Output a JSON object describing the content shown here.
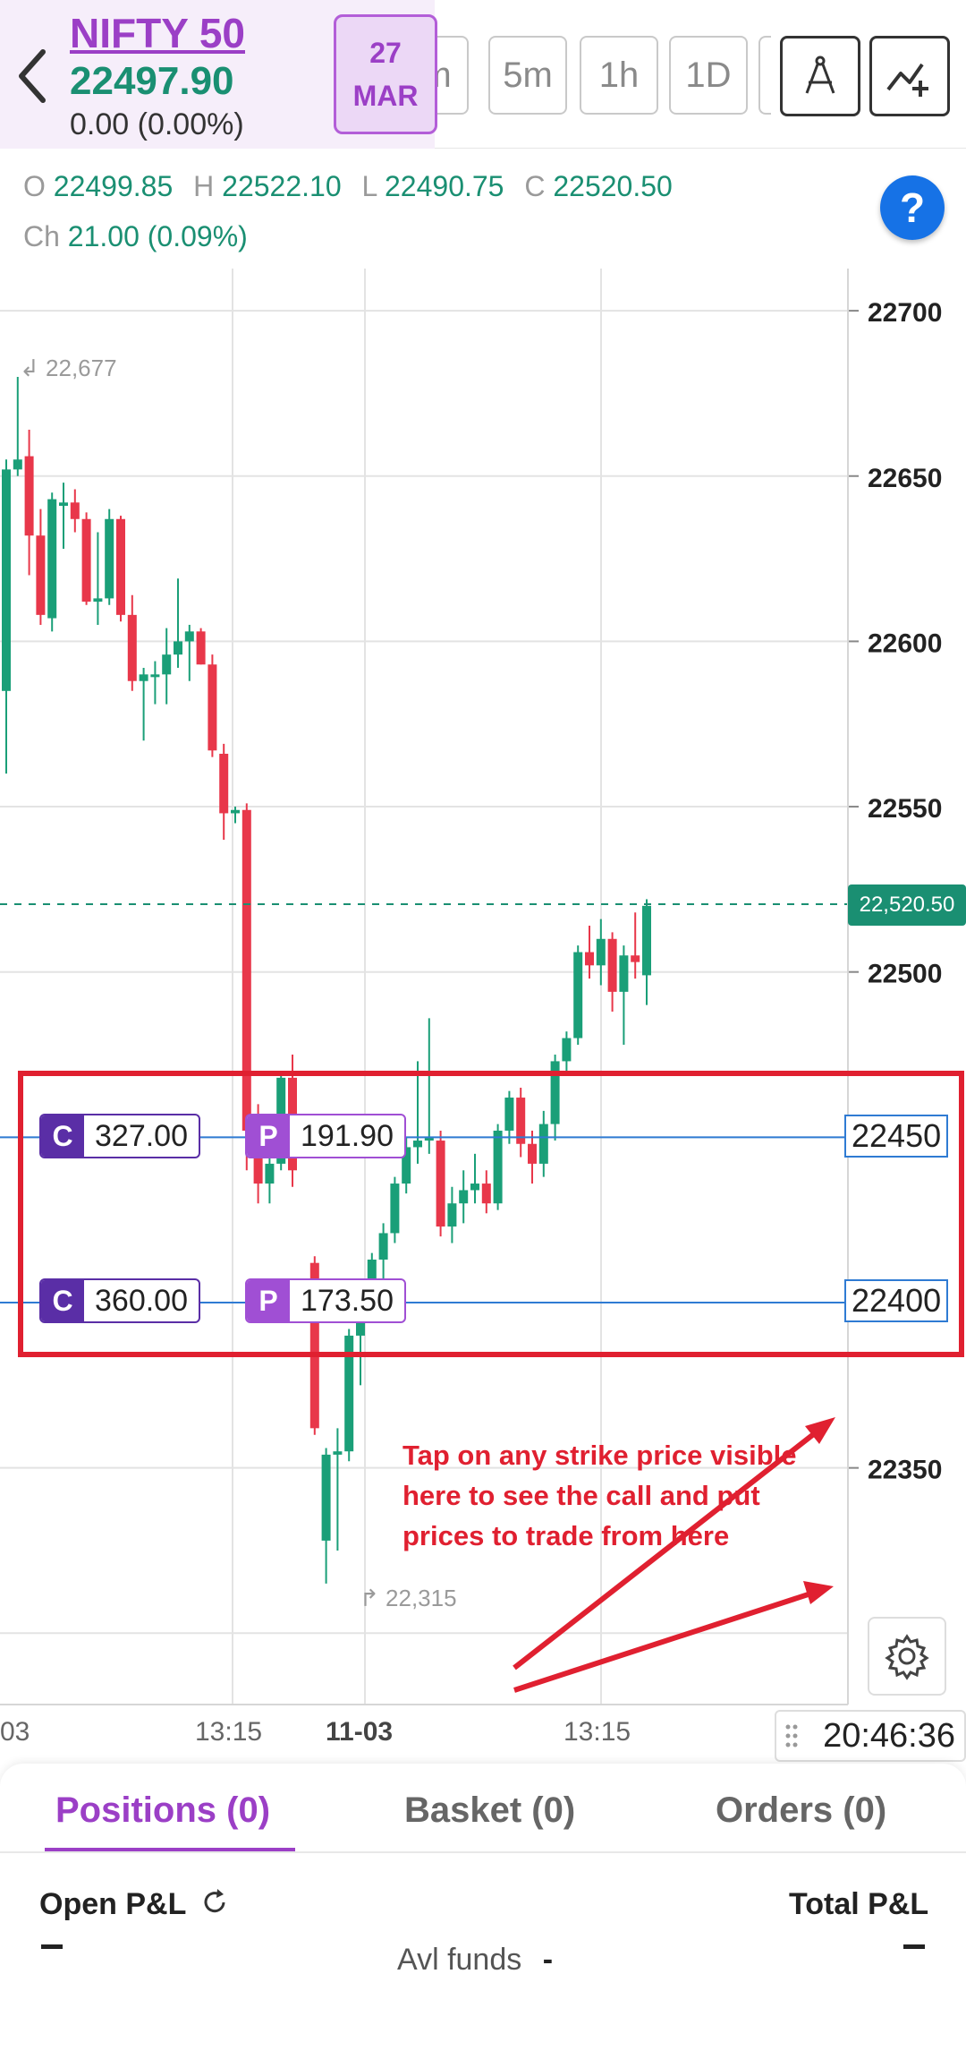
{
  "header": {
    "symbol": "NIFTY 50",
    "price": "22497.90",
    "change": "0.00 (0.00%)",
    "expiry_day": "27",
    "expiry_month": "MAR",
    "timeframes": [
      "m",
      "5m",
      "1h",
      "1D"
    ]
  },
  "ohlc": {
    "o_label": "O",
    "o": "22499.85",
    "h_label": "H",
    "h": "22522.10",
    "l_label": "L",
    "l": "22490.75",
    "c_label": "C",
    "c": "22520.50",
    "ch_label": "Ch",
    "ch": "21.00 (0.09%)"
  },
  "help": "?",
  "chart": {
    "y_ticks": [
      "22700",
      "22650",
      "22600",
      "22550",
      "22500",
      "22350"
    ],
    "last_price": "22,520.50",
    "high_label": "22,677",
    "low_label": "22,315",
    "x_labels": {
      "left_date": "03",
      "time1": "13:15",
      "date": "11-03",
      "time2": "13:15"
    },
    "clock": "20:46:36",
    "colors": {
      "up": "#1a9f78",
      "down": "#e8374a",
      "strike_line": "#2f7bd3"
    },
    "candles": [
      {
        "o": 22585,
        "h": 22655,
        "l": 22560,
        "c": 22652
      },
      {
        "o": 22652,
        "h": 22680,
        "l": 22650,
        "c": 22655
      },
      {
        "o": 22656,
        "h": 22664,
        "l": 22620,
        "c": 22632
      },
      {
        "o": 22632,
        "h": 22640,
        "l": 22605,
        "c": 22608
      },
      {
        "o": 22607,
        "h": 22645,
        "l": 22603,
        "c": 22643
      },
      {
        "o": 22641,
        "h": 22648,
        "l": 22628,
        "c": 22642
      },
      {
        "o": 22642,
        "h": 22646,
        "l": 22633,
        "c": 22637
      },
      {
        "o": 22637,
        "h": 22639,
        "l": 22611,
        "c": 22612
      },
      {
        "o": 22612,
        "h": 22633,
        "l": 22605,
        "c": 22613
      },
      {
        "o": 22613,
        "h": 22640,
        "l": 22611,
        "c": 22637
      },
      {
        "o": 22637,
        "h": 22638,
        "l": 22606,
        "c": 22608
      },
      {
        "o": 22608,
        "h": 22614,
        "l": 22585,
        "c": 22588
      },
      {
        "o": 22588,
        "h": 22592,
        "l": 22570,
        "c": 22590
      },
      {
        "o": 22590,
        "h": 22594,
        "l": 22581,
        "c": 22590
      },
      {
        "o": 22590,
        "h": 22604,
        "l": 22581,
        "c": 22596
      },
      {
        "o": 22596,
        "h": 22619,
        "l": 22592,
        "c": 22600
      },
      {
        "o": 22600,
        "h": 22605,
        "l": 22588,
        "c": 22603
      },
      {
        "o": 22603,
        "h": 22604,
        "l": 22593,
        "c": 22593
      },
      {
        "o": 22593,
        "h": 22596,
        "l": 22565,
        "c": 22567
      },
      {
        "o": 22566,
        "h": 22569,
        "l": 22540,
        "c": 22548
      },
      {
        "o": 22548,
        "h": 22550,
        "l": 22545,
        "c": 22549
      },
      {
        "o": 22549,
        "h": 22551,
        "l": 22440,
        "c": 22452
      },
      {
        "o": 22452,
        "h": 22460,
        "l": 22430,
        "c": 22436
      },
      {
        "o": 22436,
        "h": 22448,
        "l": 22430,
        "c": 22442
      },
      {
        "o": 22442,
        "h": 22470,
        "l": 22440,
        "c": 22468
      },
      {
        "o": 22468,
        "h": 22475,
        "l": 22435,
        "c": 22440
      },
      {
        "o": 22412,
        "h": 22414,
        "l": 22360,
        "c": 22362
      },
      {
        "o": 22328,
        "h": 22356,
        "l": 22315,
        "c": 22354
      },
      {
        "o": 22354,
        "h": 22362,
        "l": 22325,
        "c": 22355
      },
      {
        "o": 22355,
        "h": 22392,
        "l": 22352,
        "c": 22390
      },
      {
        "o": 22390,
        "h": 22405,
        "l": 22375,
        "c": 22402
      },
      {
        "o": 22402,
        "h": 22415,
        "l": 22398,
        "c": 22413
      },
      {
        "o": 22413,
        "h": 22424,
        "l": 22395,
        "c": 22421
      },
      {
        "o": 22421,
        "h": 22438,
        "l": 22418,
        "c": 22436
      },
      {
        "o": 22436,
        "h": 22450,
        "l": 22433,
        "c": 22447
      },
      {
        "o": 22447,
        "h": 22473,
        "l": 22442,
        "c": 22449
      },
      {
        "o": 22449,
        "h": 22486,
        "l": 22445,
        "c": 22450
      },
      {
        "o": 22449,
        "h": 22452,
        "l": 22420,
        "c": 22423
      },
      {
        "o": 22423,
        "h": 22435,
        "l": 22418,
        "c": 22430
      },
      {
        "o": 22430,
        "h": 22440,
        "l": 22424,
        "c": 22434
      },
      {
        "o": 22434,
        "h": 22445,
        "l": 22430,
        "c": 22436
      },
      {
        "o": 22436,
        "h": 22440,
        "l": 22427,
        "c": 22430
      },
      {
        "o": 22430,
        "h": 22454,
        "l": 22428,
        "c": 22452
      },
      {
        "o": 22452,
        "h": 22464,
        "l": 22448,
        "c": 22462
      },
      {
        "o": 22462,
        "h": 22465,
        "l": 22444,
        "c": 22448
      },
      {
        "o": 22448,
        "h": 22452,
        "l": 22436,
        "c": 22442
      },
      {
        "o": 22442,
        "h": 22458,
        "l": 22438,
        "c": 22454
      },
      {
        "o": 22454,
        "h": 22475,
        "l": 22449,
        "c": 22473
      },
      {
        "o": 22473,
        "h": 22482,
        "l": 22469,
        "c": 22480
      },
      {
        "o": 22480,
        "h": 22508,
        "l": 22478,
        "c": 22506
      },
      {
        "o": 22506,
        "h": 22514,
        "l": 22498,
        "c": 22502
      },
      {
        "o": 22502,
        "h": 22516,
        "l": 22496,
        "c": 22510
      },
      {
        "o": 22510,
        "h": 22512,
        "l": 22488,
        "c": 22494
      },
      {
        "o": 22494,
        "h": 22508,
        "l": 22478,
        "c": 22505
      },
      {
        "o": 22505,
        "h": 22518,
        "l": 22498,
        "c": 22503
      },
      {
        "o": 22499,
        "h": 22522,
        "l": 22490,
        "c": 22520
      }
    ],
    "strikes": [
      {
        "strike": "22450",
        "price": 22450,
        "call_tag": "C",
        "call": "327.00",
        "put_tag": "P",
        "put": "191.90"
      },
      {
        "strike": "22400",
        "price": 22400,
        "call_tag": "C",
        "call": "360.00",
        "put_tag": "P",
        "put": "173.50"
      }
    ]
  },
  "annotation": {
    "text": "Tap on any strike price visible here to see the call and put prices to trade from here"
  },
  "tabs": [
    {
      "label": "Positions (0)"
    },
    {
      "label": "Basket (0)"
    },
    {
      "label": "Orders (0)"
    }
  ],
  "pnl": {
    "open_label": "Open P&L",
    "open_value": "-",
    "total_label": "Total P&L",
    "total_value": "-",
    "funds_label": "Avl funds",
    "funds_value": "-"
  }
}
